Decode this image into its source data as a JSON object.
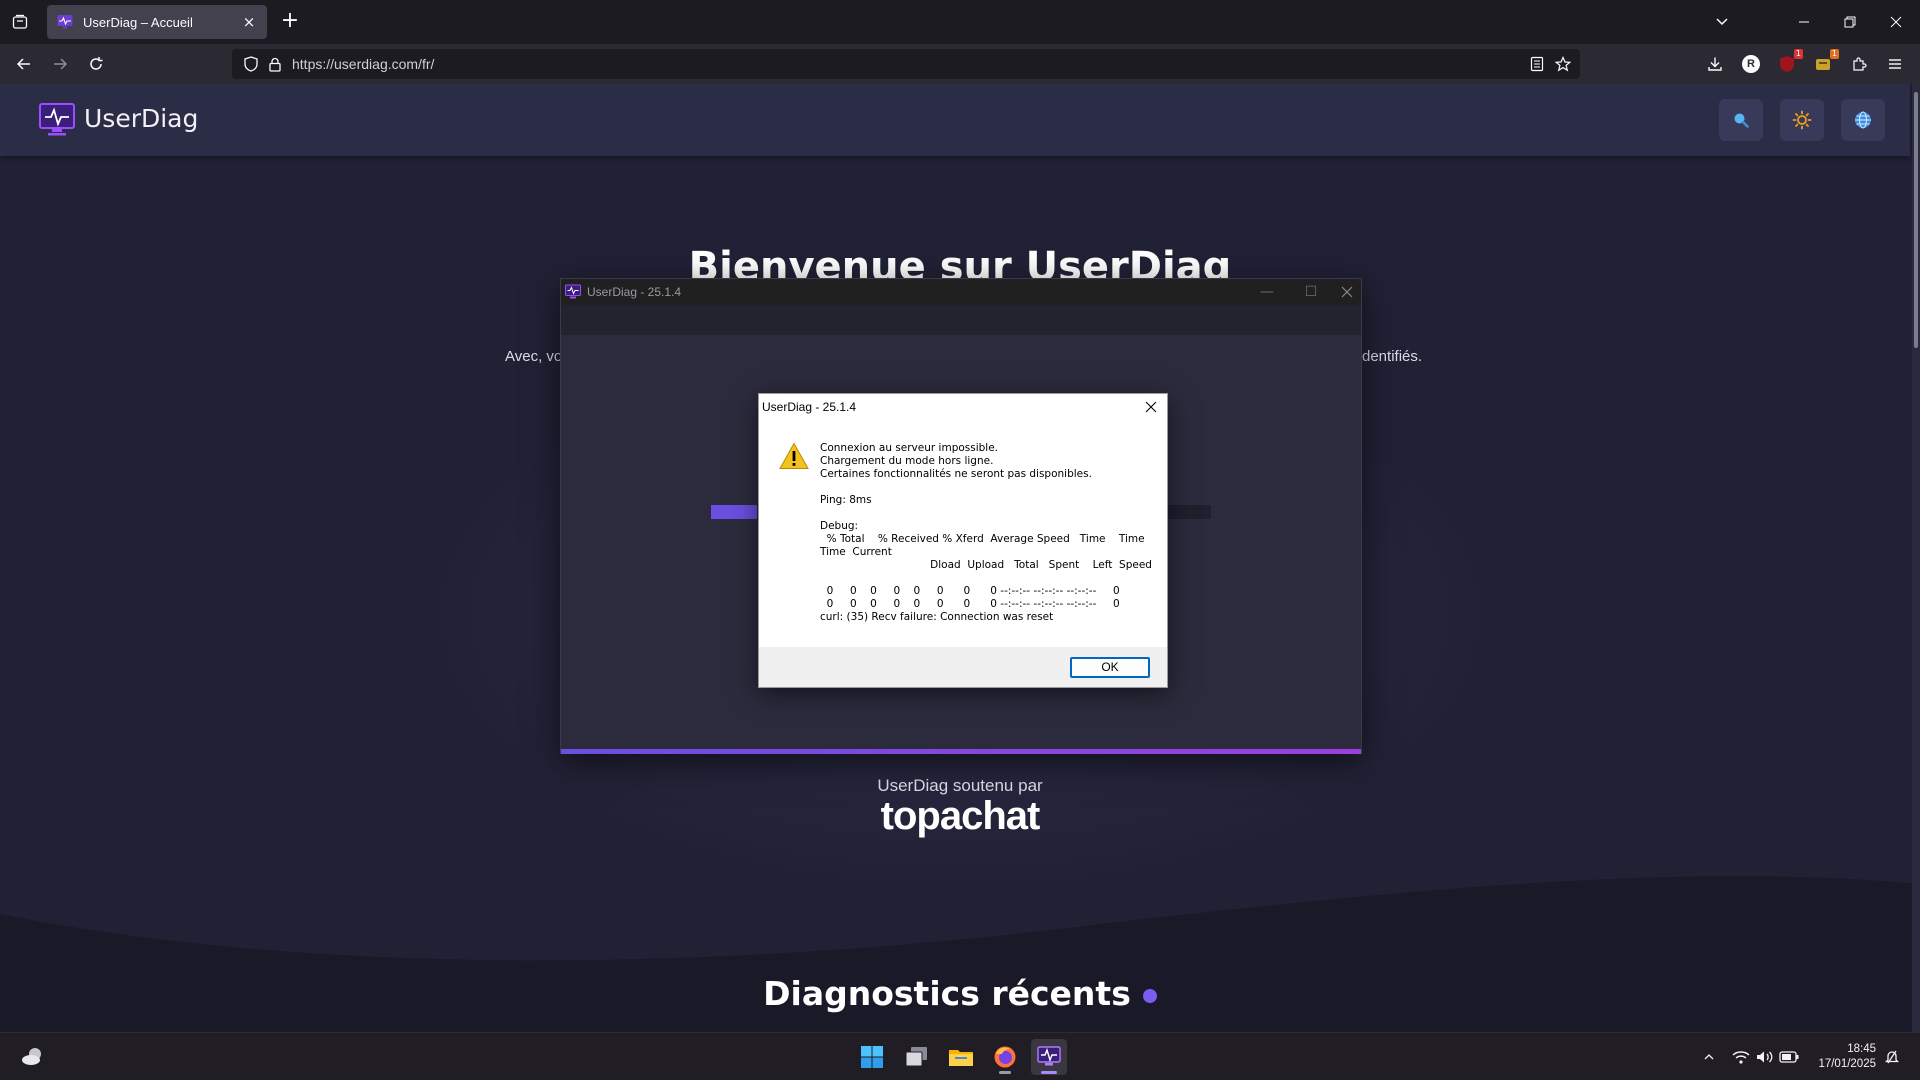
{
  "browser": {
    "tab_title": "UserDiag – Accueil",
    "tab_close": "×",
    "new_tab": "+",
    "url": "https://userdiag.com/fr/",
    "extension_badges": [
      "1",
      "1"
    ],
    "profile_initial": "R"
  },
  "site": {
    "logo_text": "UserDiag",
    "header_buttons": [
      "search-icon",
      "sun-icon",
      "globe-icon"
    ],
    "hero_title": "Bienvenue sur UserDiag",
    "hero_sub_left": "Avec, vo",
    "hero_sub_right": "dentifiés.",
    "sponsor_label": "UserDiag soutenu par",
    "sponsor_logo": "topachat",
    "recent_title": "Diagnostics récents",
    "accent_color": "#7a5cf0"
  },
  "app_window": {
    "title": "UserDiag - 25.1.4"
  },
  "dialog": {
    "title": "UserDiag - 25.1.4",
    "icon": "warning-icon",
    "message": "Connexion au serveur impossible.\nChargement du mode hors ligne.\nCertaines fonctionnalités ne seront pas disponibles.\n\nPing: 8ms\n\nDebug:\n  % Total    % Received % Xferd  Average Speed   Time    Time\nTime  Current\n                                 Dload  Upload   Total   Spent    Left  Speed\n\n  0     0    0     0    0     0      0      0 --:--:-- --:--:-- --:--:--     0\n  0     0    0     0    0     0      0      0 --:--:-- --:--:-- --:--:--     0\ncurl: (35) Recv failure: Connection was reset",
    "ok_label": "OK"
  },
  "taskbar": {
    "apps": [
      "windows-start-icon",
      "task-view-icon",
      "file-explorer-icon",
      "firefox-icon",
      "userdiag-icon"
    ],
    "time": "18:45",
    "date": "17/01/2025"
  }
}
